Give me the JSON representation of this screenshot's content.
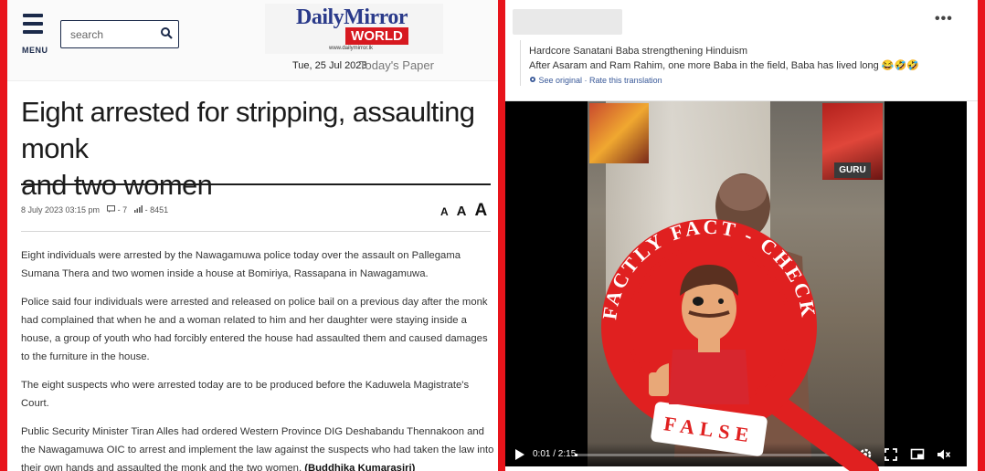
{
  "left_panel": {
    "menu_label": "MENU",
    "search": {
      "placeholder": "search"
    },
    "logo": {
      "line1": "DailyMirror",
      "line2": "WORLD",
      "url": "www.dailymirror.lk"
    },
    "date": "Tue, 25 Jul 2023",
    "todays_paper": "Today's Paper",
    "headline_line1": "Eight arrested for stripping, assaulting monk",
    "headline_line2": "and two women",
    "meta": {
      "date": "8 July 2023 03:15 pm",
      "comments": "7",
      "views": "8451"
    },
    "font_controls": [
      "A",
      "A",
      "A"
    ],
    "paragraphs": [
      "Eight individuals were arrested by the Nawagamuwa police today over the assault on Pallegama Sumana Thera and two women inside a house at Bomiriya, Rassapana in Nawagamuwa.",
      "Police said four individuals were arrested and released on police bail on a previous day after the monk had complained that when he and a woman related to him and her daughter were staying inside a house, a group of youth who had forcibly entered the house had assaulted them and caused damages to the furniture in the house.",
      "The eight suspects who were arrested today are to be produced before the Kaduwela Magistrate's Court.",
      "Public Security Minister Tiran Alles had ordered Western Province DIG Deshabandu Thennakoon and the Nawagamuwa OIC to arrest and implement the law against the suspects who had taken the law into their own hands and assaulted the monk and the two women."
    ],
    "byline": "(Buddhika Kumarasiri)"
  },
  "right_panel": {
    "more": "•••",
    "caption_line1": "Hardcore Sanatani Baba strengthening Hinduism",
    "caption_line2": "After Asaram and Ram Rahim, one more Baba in the field, Baba has lived long 😂🤣🤣",
    "see_original": "See original · Rate this translation",
    "thumb_label": "GURU",
    "video": {
      "time": "0:01 / 2:15",
      "progress": 0.01
    }
  },
  "stamp": {
    "top_text": "FACTLY FACT - CHECK",
    "bottom_text": "FALSE",
    "colors": {
      "red": "#e02020",
      "white": "#ffffff"
    }
  }
}
